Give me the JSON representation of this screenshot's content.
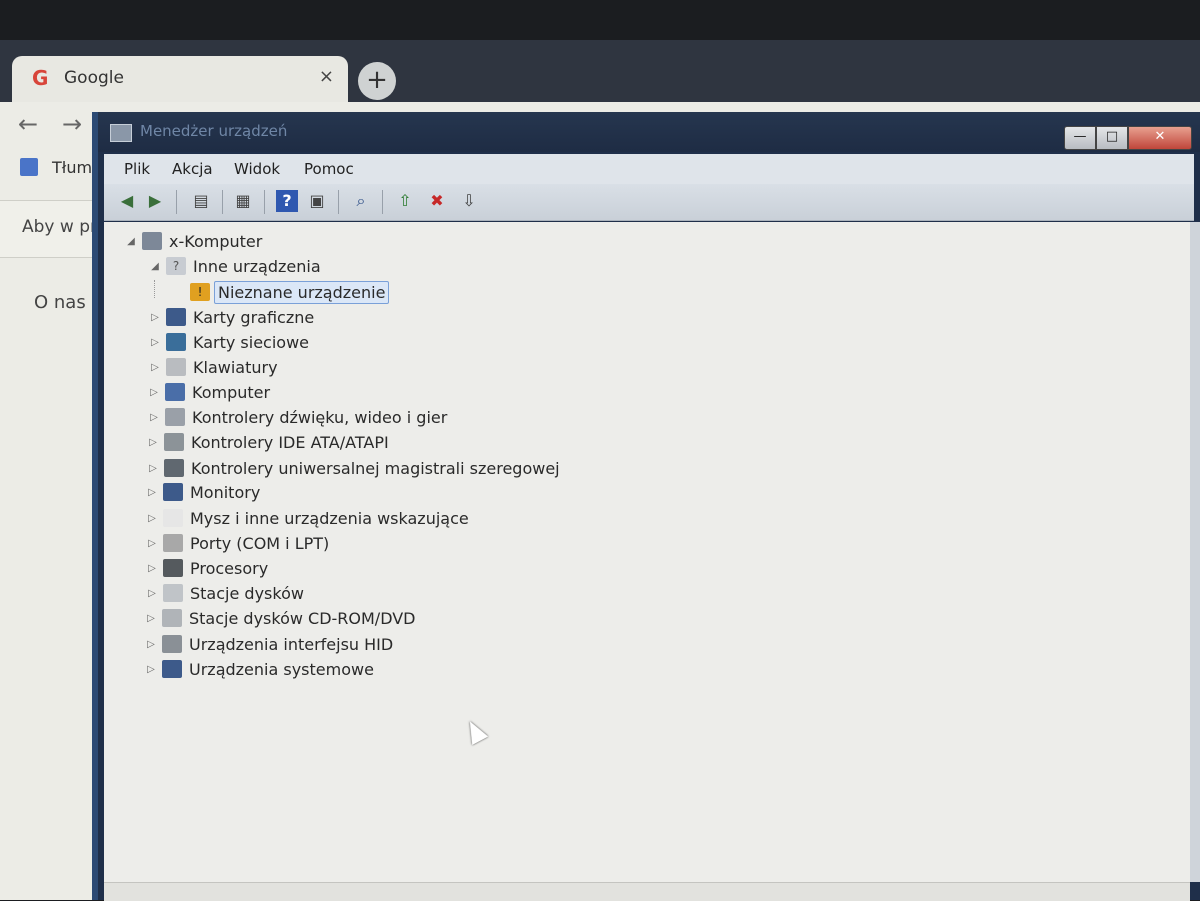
{
  "chrome": {
    "tab_title": "Google",
    "tab_logo": "G",
    "tab_close": "×",
    "new_tab": "+",
    "back_icon": "←",
    "forward_icon": "→",
    "bookmark_label": "Tłuma",
    "notice_text": "Aby w pr",
    "about_link": "O nas"
  },
  "device_manager": {
    "title": "Menedżer urządzeń",
    "caption": {
      "minimize": "—",
      "maximize": "□",
      "close": "✕"
    },
    "menu": [
      "Plik",
      "Akcja",
      "Widok",
      "Pomoc"
    ],
    "toolbar_icons": [
      "back-icon",
      "forward-icon",
      "show-hide-tree-icon",
      "properties-icon",
      "help-icon",
      "view-icon",
      "scan-hardware-icon",
      "update-driver-icon",
      "uninstall-icon",
      "disable-icon"
    ],
    "tree": {
      "root": "x-Komputer",
      "other_devices": "Inne urządzenia",
      "unknown_device": "Nieznane urządzenie",
      "categories": [
        "Karty graficzne",
        "Karty sieciowe",
        "Klawiatury",
        "Komputer",
        "Kontrolery dźwięku, wideo i gier",
        "Kontrolery IDE ATA/ATAPI",
        "Kontrolery uniwersalnej magistrali szeregowej",
        "Monitory",
        "Mysz i inne urządzenia wskazujące",
        "Porty (COM i LPT)",
        "Procesory",
        "Stacje dysków",
        "Stacje dysków CD-ROM/DVD",
        "Urządzenia interfejsu HID",
        "Urządzenia systemowe"
      ]
    }
  },
  "colors": {
    "titlebar": "#1e2c44",
    "selection": "#dbe7f7",
    "warning": "#e0a020"
  }
}
